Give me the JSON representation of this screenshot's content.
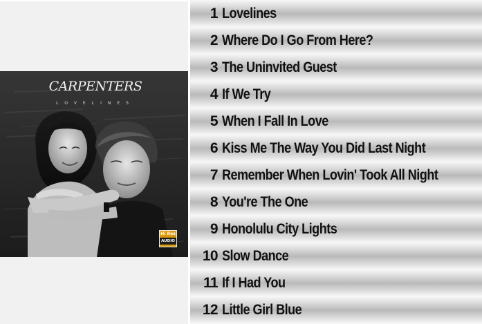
{
  "album": {
    "artist_logo": "CARPENTERS",
    "title": "LOVELINES",
    "badge_line1": "Hi Res",
    "badge_line2": "AUDIO"
  },
  "tracks": [
    {
      "number": "1",
      "title": "Lovelines"
    },
    {
      "number": "2",
      "title": "Where Do I Go From Here?"
    },
    {
      "number": "3",
      "title": "The Uninvited Guest"
    },
    {
      "number": "4",
      "title": "If We Try"
    },
    {
      "number": "5",
      "title": "When I Fall In Love"
    },
    {
      "number": "6",
      "title": "Kiss Me The Way You Did Last Night"
    },
    {
      "number": "7",
      "title": "Remember When Lovin' Took All Night"
    },
    {
      "number": "8",
      "title": "You're The One"
    },
    {
      "number": "9",
      "title": "Honolulu City Lights"
    },
    {
      "number": "10",
      "title": "Slow Dance"
    },
    {
      "number": "11",
      "title": "If I Had You"
    },
    {
      "number": "12",
      "title": "Little Girl Blue"
    }
  ],
  "colors": {
    "badge_gold": "#d89a12",
    "cover_dark": "#2b2b2b",
    "text": "#111111"
  }
}
